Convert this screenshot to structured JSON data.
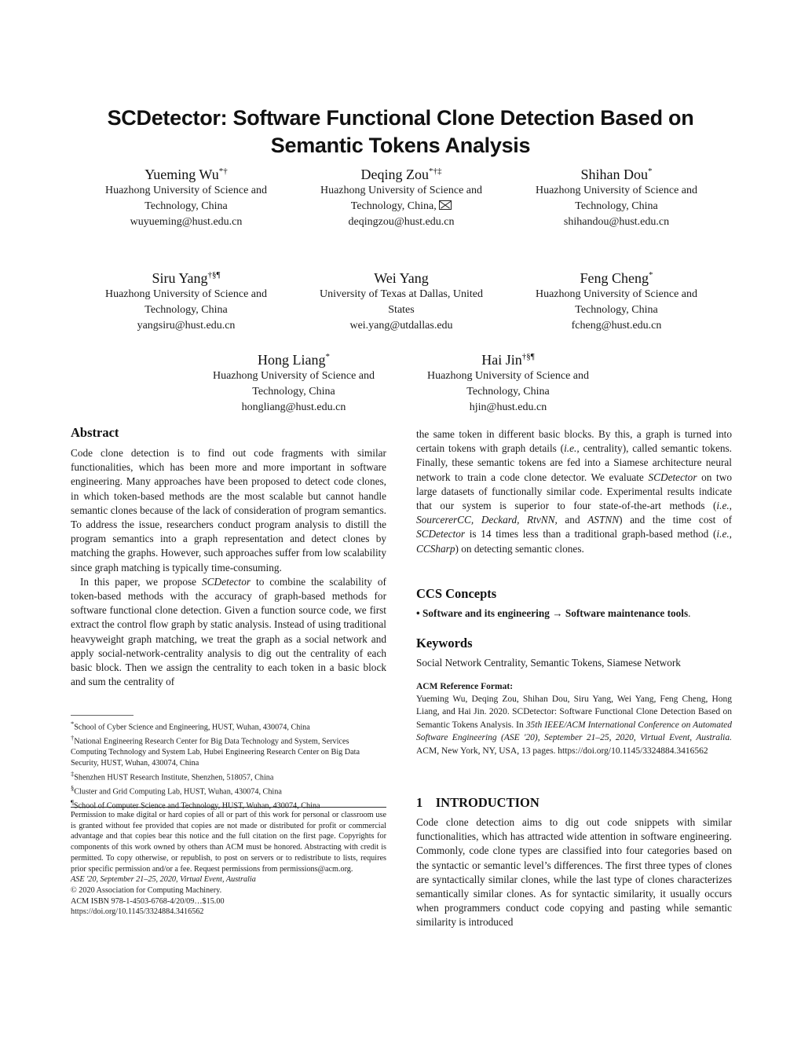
{
  "paper": {
    "title_line1": "SCDetector: Software Functional Clone Detection Based on",
    "title_line2": "Semantic Tokens Analysis"
  },
  "authors": [
    {
      "name": "Yueming Wu",
      "marks": "*†",
      "aff1": "Huazhong University of Science and",
      "aff2": "Technology, China",
      "email": "wuyueming@hust.edu.cn"
    },
    {
      "name": "Deqing Zou",
      "marks": "*†‡",
      "aff1": "Huazhong University of Science and",
      "aff2": "Technology, China,",
      "email": "deqingzou@hust.edu.cn",
      "icon": "envelope-icon"
    },
    {
      "name": "Shihan Dou",
      "marks": "*",
      "aff1": "Huazhong University of Science and",
      "aff2": "Technology, China",
      "email": "shihandou@hust.edu.cn"
    },
    {
      "name": "Siru Yang",
      "marks": "†§¶",
      "aff1": "Huazhong University of Science and",
      "aff2": "Technology, China",
      "email": "yangsiru@hust.edu.cn"
    },
    {
      "name": "Wei Yang",
      "marks": "",
      "aff1": "University of Texas at Dallas, United",
      "aff2": "States",
      "email": "wei.yang@utdallas.edu"
    },
    {
      "name": "Feng Cheng",
      "marks": "*",
      "aff1": "Huazhong University of Science and",
      "aff2": "Technology, China",
      "email": "fcheng@hust.edu.cn"
    },
    {
      "name": "Hong Liang",
      "marks": "*",
      "aff1": "Huazhong University of Science and",
      "aff2": "Technology, China",
      "email": "hongliang@hust.edu.cn"
    },
    {
      "name": "Hai Jin",
      "marks": "†§¶",
      "aff1": "Huazhong University of Science and",
      "aff2": "Technology, China",
      "email": "hjin@hust.edu.cn"
    }
  ],
  "abstract": {
    "heading": "Abstract",
    "p1": "Code clone detection is to find out code fragments with similar functionalities, which has been more and more important in software engineering. Many approaches have been proposed to detect code clones, in which token-based methods are the most scalable but cannot handle semantic clones because of the lack of consideration of program semantics. To address the issue, researchers conduct program analysis to distill the program semantics into a graph representation and detect clones by matching the graphs. However, such approaches suffer from low scalability since graph matching is typically time-consuming.",
    "p2_a": "In this paper, we propose ",
    "p2_sys": "SCDetector",
    "p2_b": " to combine the scalability of token-based methods with the accuracy of graph-based methods for software functional clone detection. Given a function source code, we first extract the control flow graph by static analysis. Instead of using traditional heavyweight graph matching, we treat the graph as a social network and apply social-network-centrality analysis to dig out the centrality of each basic block. Then we assign the centrality to each token in a basic block and sum the centrality of the same token in different basic blocks. By this, a graph is turned into certain tokens with graph details (",
    "p2_ie1": "i.e.,",
    "p2_c": " centrality), called semantic tokens. Finally, these semantic tokens are fed into a Siamese architecture neural network to train a code clone detector. We evaluate ",
    "p2_sys2": "SCDetector",
    "p2_d": " on two large datasets of functionally similar code. Experimental results indicate that our system is superior to four state-of-the-art methods (",
    "p2_ie2": "i.e., SourcererCC, Deckard, RtvNN,",
    "p2_e": " and ",
    "p2_astnn": "ASTNN",
    "p2_f": ") and the time cost of ",
    "p2_sys3": "SCDetector",
    "p2_g": " is 14 times less than a traditional graph-based method (",
    "p2_ie3": "i.e., CCSharp",
    "p2_h": ") on detecting semantic clones."
  },
  "footnotes": [
    {
      "mark": "*",
      "text": "School of Cyber Science and Engineering, HUST, Wuhan, 430074, China"
    },
    {
      "mark": "†",
      "text": "National Engineering Research Center for Big Data Technology and System, Services Computing Technology and System Lab, Hubei Engineering Research Center on Big Data Security, HUST, Wuhan, 430074, China"
    },
    {
      "mark": "‡",
      "text": "Shenzhen HUST Research Institute, Shenzhen, 518057, China"
    },
    {
      "mark": "§",
      "text": "Cluster and Grid Computing Lab, HUST, Wuhan, 430074, China"
    },
    {
      "mark": "¶",
      "text": "School of Computer Science and Technology, HUST, Wuhan, 430074, China"
    }
  ],
  "permission": {
    "text": "Permission to make digital or hard copies of all or part of this work for personal or classroom use is granted without fee provided that copies are not made or distributed for profit or commercial advantage and that copies bear this notice and the full citation on the first page. Copyrights for components of this work owned by others than ACM must be honored. Abstracting with credit is permitted. To copy otherwise, or republish, to post on servers or to redistribute to lists, requires prior specific permission and/or a fee. Request permissions from permissions@acm.org.",
    "venue": "ASE '20, September 21–25, 2020, Virtual Event, Australia",
    "copyright": "© 2020 Association for Computing Machinery.",
    "isbn": "ACM ISBN 978-1-4503-6768-4/20/09…$15.00",
    "doi": "https://doi.org/10.1145/3324884.3416562"
  },
  "ccs": {
    "heading": "CCS Concepts",
    "item_a": "• Software and its engineering → Software maintenance tools",
    "item_end": "."
  },
  "keywords": {
    "heading": "Keywords",
    "text": "Social Network Centrality, Semantic Tokens, Siamese Network"
  },
  "reference": {
    "heading": "ACM Reference Format:",
    "text_a": "Yueming Wu, Deqing Zou, Shihan Dou, Siru Yang, Wei Yang, Feng Cheng, Hong Liang, and Hai Jin. 2020. SCDetector: Software Functional Clone Detection Based on Semantic Tokens Analysis. In ",
    "text_venue": "35th IEEE/ACM International Conference on Automated Software Engineering (ASE '20), September 21–25, 2020, Virtual Event, Australia.",
    "text_b": " ACM, New York, NY, USA, 13 pages. https://doi.org/10.1145/3324884.3416562"
  },
  "introduction": {
    "heading": "1    INTRODUCTION",
    "text": "Code clone detection aims to dig out code snippets with similar functionalities, which has attracted wide attention in software engineering. Commonly, code clone types are classified into four categories based on the syntactic or semantic level’s differences. The first three types of clones are syntactically similar clones, while the last type of clones characterizes semantically similar clones. As for syntactic similarity, it usually occurs when programmers conduct code copying and pasting while semantic similarity is introduced"
  }
}
